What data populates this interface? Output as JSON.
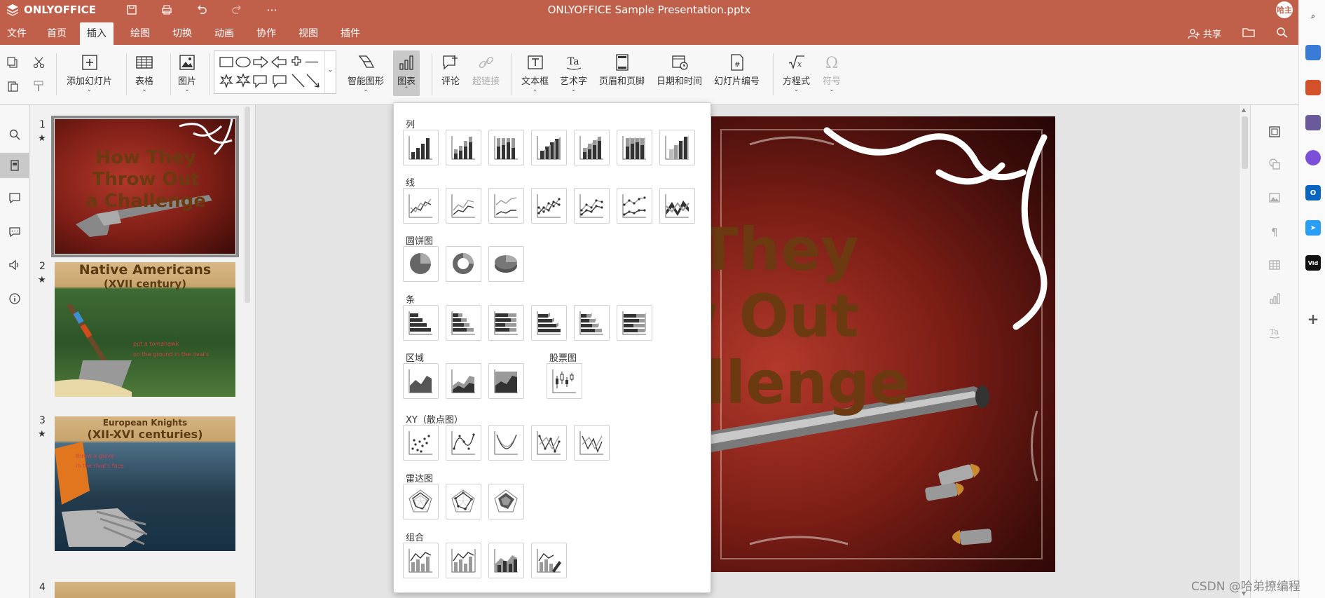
{
  "app": {
    "name": "ONLYOFFICE",
    "doc_title": "ONLYOFFICE Sample Presentation.pptx",
    "user_initials": "哈主"
  },
  "menu": {
    "tabs": [
      "文件",
      "首页",
      "插入",
      "绘图",
      "切换",
      "动画",
      "协作",
      "视图",
      "插件"
    ],
    "active": "插入",
    "share": "共享"
  },
  "toolbar": {
    "add_slide": "添加幻灯片",
    "table": "表格",
    "image": "图片",
    "smartart": "智能图形",
    "chart": "图表",
    "comment": "评论",
    "hyperlink": "超链接",
    "textbox": "文本框",
    "textart": "艺术字",
    "header_footer": "页眉和页脚",
    "datetime": "日期和时间",
    "slide_number": "幻灯片编号",
    "equation": "方程式",
    "symbol": "符号"
  },
  "slides": [
    {
      "num": "1",
      "title_lines": [
        "How They",
        "Throw Out",
        "a Challenge"
      ]
    },
    {
      "num": "2",
      "title": "Native Americans",
      "subtitle": "(XVII century)",
      "bullets": [
        "put a tomahawk",
        "on the ground in the rival's"
      ]
    },
    {
      "num": "3",
      "title": "European Knights",
      "subtitle": "(XII-XVI centuries)",
      "bullets": [
        "threw a glove",
        "in the rival's face"
      ]
    },
    {
      "num": "4"
    }
  ],
  "main_slide": {
    "lines": [
      "w They",
      "ow Out",
      "hallenge"
    ]
  },
  "chart_menu": {
    "sections": [
      "列",
      "线",
      "圆饼图",
      "条",
      "区域",
      "股票图",
      "XY（散点图）",
      "雷达图",
      "组合"
    ]
  },
  "colors": {
    "accent": "#c0604b",
    "toolbar_bg": "#f7f7f7"
  },
  "watermark": "CSDN @哈弟撩编程"
}
